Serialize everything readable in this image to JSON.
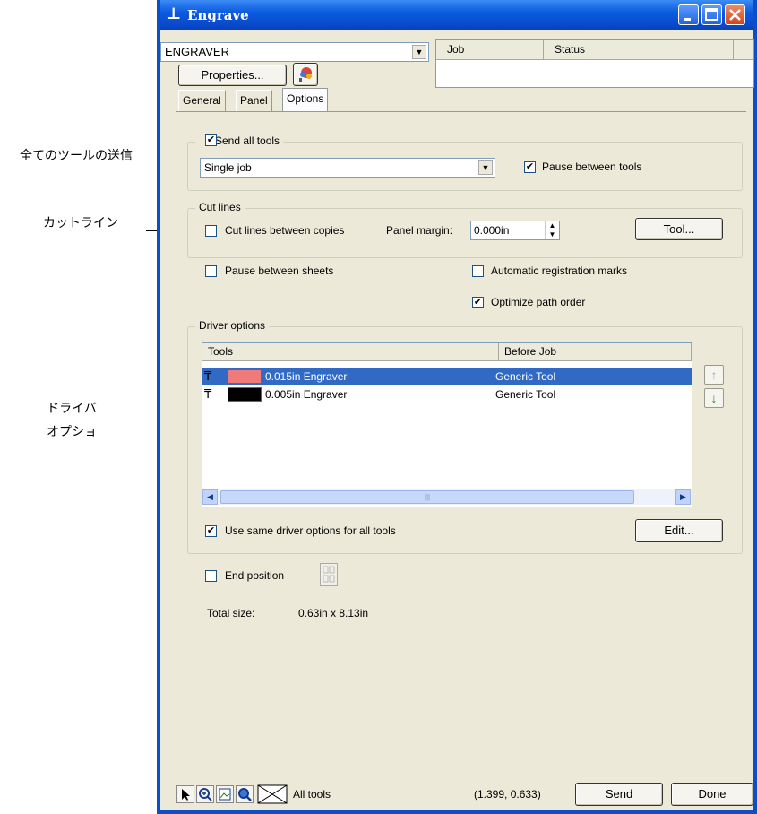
{
  "annotations": [
    "全てのツールの送信",
    "カットライン",
    "ドライバ\nオプショ"
  ],
  "window": {
    "title": "Engrave",
    "device": "ENGRAVER",
    "properties_label": "Properties...",
    "job_columns": [
      "Job",
      "Status"
    ]
  },
  "tabs": [
    "General",
    "Panel",
    "Options"
  ],
  "send_all_tools": {
    "legend": "Send all tools",
    "checked": true,
    "mode": "Single job",
    "pause_between_tools": "Pause between tools",
    "pause_checked": true
  },
  "cut_lines": {
    "legend": "Cut lines",
    "between_copies": "Cut lines between copies",
    "between_copies_checked": false,
    "panel_margin_label": "Panel margin:",
    "panel_margin_value": "0.000in",
    "tool_button": "Tool..."
  },
  "misc": {
    "pause_between_sheets": "Pause between sheets",
    "pause_between_sheets_checked": false,
    "auto_reg_marks": "Automatic registration marks",
    "auto_reg_marks_checked": false,
    "optimize_path": "Optimize path order",
    "optimize_path_checked": true
  },
  "driver_options": {
    "legend": "Driver options",
    "columns": [
      "Tools",
      "Before Job"
    ],
    "rows": [
      {
        "name": "0.015in Engraver",
        "before_job": "Generic Tool",
        "color": "#f07a7a",
        "selected": true
      },
      {
        "name": "0.005in Engraver",
        "before_job": "Generic Tool",
        "color": "#000000",
        "selected": false
      }
    ],
    "same_options": "Use same driver options for all tools",
    "same_options_checked": true,
    "edit_button": "Edit..."
  },
  "end_position": {
    "label": "End position",
    "checked": false
  },
  "total_size": {
    "label": "Total size:",
    "value": "0.63in x 8.13in"
  },
  "statusbar": {
    "filter": "All tools",
    "coords": "(1.399, 0.633)",
    "send": "Send",
    "done": "Done"
  }
}
